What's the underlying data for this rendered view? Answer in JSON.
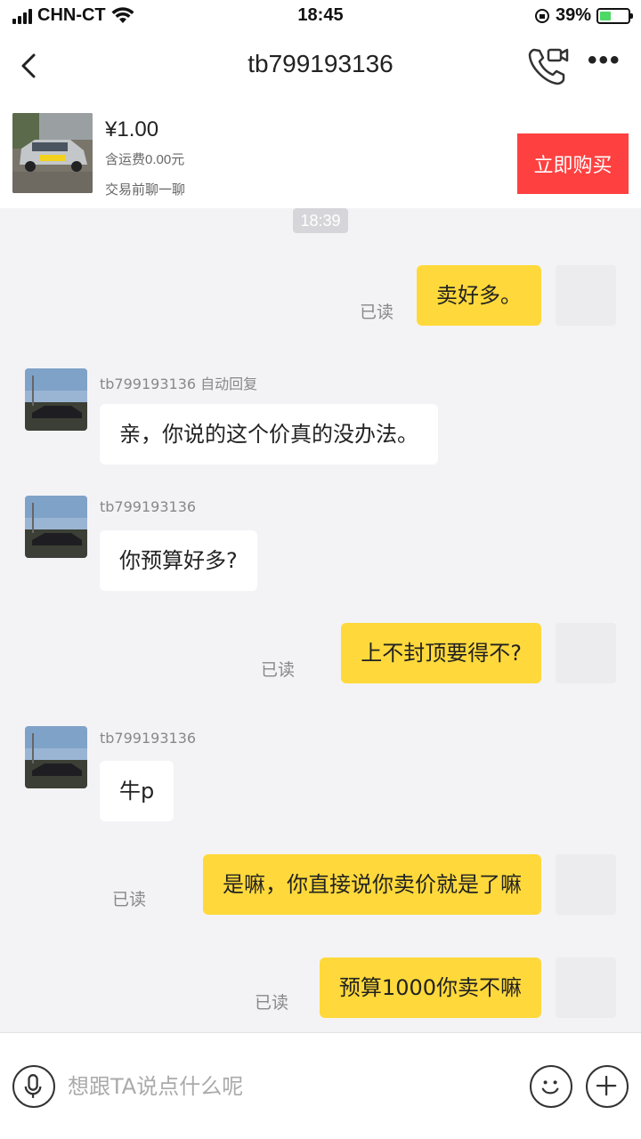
{
  "status_bar": {
    "carrier": "CHN-CT",
    "time": "18:45",
    "battery_text": "39%",
    "battery_level": 0.39
  },
  "nav": {
    "title": "tb799193136"
  },
  "product": {
    "price": "¥1.00",
    "shipping": "含运费0.00元",
    "note": "交易前聊一聊",
    "buy_label": "立即购买"
  },
  "chat": {
    "timestamp": "18:39",
    "read_label": "已读",
    "messages": [
      {
        "dir": "out",
        "text": "卖好多。"
      },
      {
        "dir": "in",
        "sender": "tb799193136 自动回复",
        "text": "亲，你说的这个价真的没办法。"
      },
      {
        "dir": "in",
        "sender": "tb799193136",
        "text": "你预算好多?"
      },
      {
        "dir": "out",
        "text": "上不封顶要得不?"
      },
      {
        "dir": "in",
        "sender": "tb799193136",
        "text": "牛p"
      },
      {
        "dir": "out",
        "text": "是嘛，你直接说你卖价就是了嘛"
      },
      {
        "dir": "out",
        "text": "预算1000你卖不嘛"
      }
    ]
  },
  "input": {
    "placeholder": "想跟TA说点什么呢"
  },
  "colors": {
    "accent_yellow": "#ffd93b",
    "buy_red": "#ff4040",
    "background": "#f3f3f6"
  },
  "icons": [
    "back-icon",
    "video-call-icon",
    "more-icon",
    "microphone-icon",
    "emoji-icon",
    "plus-icon"
  ]
}
